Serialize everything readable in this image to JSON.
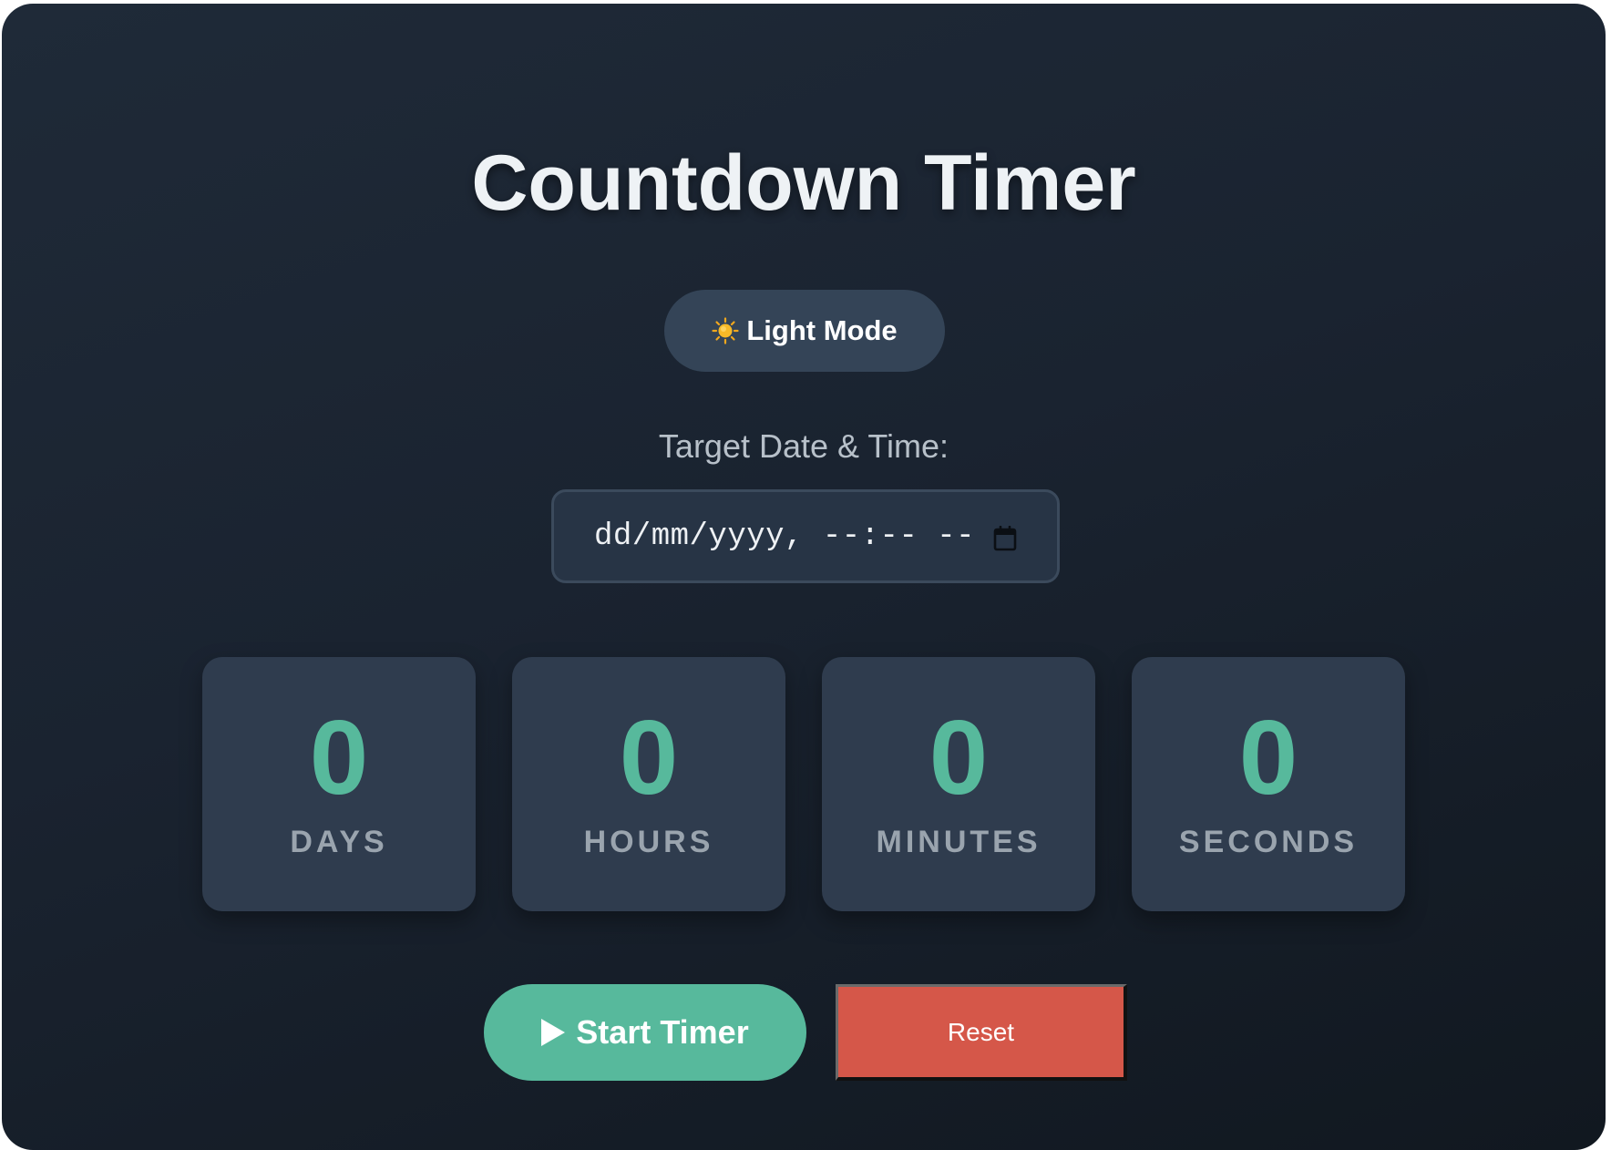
{
  "title": "Countdown Timer",
  "theme_toggle": {
    "icon": "sun-icon",
    "label": "Light Mode"
  },
  "target": {
    "label": "Target Date & Time:",
    "placeholder": "dd/mm/yyyy, --:-- --",
    "value": ""
  },
  "countdown": [
    {
      "value": "0",
      "label": "DAYS"
    },
    {
      "value": "0",
      "label": "HOURS"
    },
    {
      "value": "0",
      "label": "MINUTES"
    },
    {
      "value": "0",
      "label": "SECONDS"
    }
  ],
  "buttons": {
    "start_label": "Start Timer",
    "start_icon": "play-icon",
    "reset_label": "Reset"
  },
  "colors": {
    "background": "#1b2431",
    "card": "#2f3c4e",
    "accent": "#57b99c",
    "danger": "#d55749",
    "toggle": "#344457"
  }
}
